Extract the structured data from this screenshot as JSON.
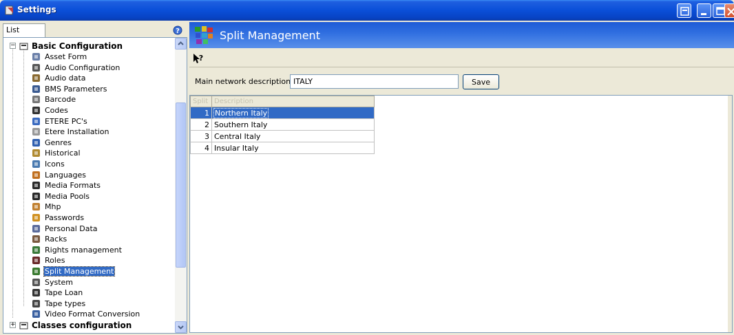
{
  "window": {
    "title": "Settings"
  },
  "left": {
    "tab_label": "List",
    "groups": [
      {
        "label": "Basic Configuration",
        "expanded": true,
        "items": [
          {
            "label": "Asset Form",
            "icon": "asset-form-icon"
          },
          {
            "label": "Audio Configuration",
            "icon": "audio-config-icon"
          },
          {
            "label": "Audio data",
            "icon": "audio-data-icon"
          },
          {
            "label": "BMS Parameters",
            "icon": "bms-icon"
          },
          {
            "label": "Barcode",
            "icon": "barcode-icon"
          },
          {
            "label": "Codes",
            "icon": "codes-icon"
          },
          {
            "label": "ETERE PC's",
            "icon": "pc-icon"
          },
          {
            "label": "Etere Installation",
            "icon": "installation-icon"
          },
          {
            "label": "Genres",
            "icon": "genres-icon"
          },
          {
            "label": "Historical",
            "icon": "historical-icon"
          },
          {
            "label": "Icons",
            "icon": "icons-icon"
          },
          {
            "label": "Languages",
            "icon": "languages-icon"
          },
          {
            "label": "Media Formats",
            "icon": "media-formats-icon"
          },
          {
            "label": "Media Pools",
            "icon": "media-pools-icon"
          },
          {
            "label": "Mhp",
            "icon": "mhp-icon"
          },
          {
            "label": "Passwords",
            "icon": "passwords-icon"
          },
          {
            "label": "Personal Data",
            "icon": "personal-data-icon"
          },
          {
            "label": "Racks",
            "icon": "racks-icon"
          },
          {
            "label": "Rights management",
            "icon": "rights-icon"
          },
          {
            "label": "Roles",
            "icon": "roles-icon"
          },
          {
            "label": "Split Management",
            "icon": "split-icon",
            "selected": true
          },
          {
            "label": "System",
            "icon": "system-icon"
          },
          {
            "label": "Tape Loan",
            "icon": "tape-loan-icon"
          },
          {
            "label": "Tape types",
            "icon": "tape-types-icon"
          },
          {
            "label": "Video Format Conversion",
            "icon": "video-format-icon"
          }
        ]
      },
      {
        "label": "Classes configuration",
        "expanded": false
      }
    ]
  },
  "right": {
    "header_title": "Split Management",
    "form": {
      "network_label": "Main network description",
      "network_value": "ITALY",
      "save_label": "Save"
    },
    "grid": {
      "columns": [
        "Split",
        "Description"
      ],
      "rows": [
        {
          "num": "1",
          "desc": "Northern Italy",
          "selected": true
        },
        {
          "num": "2",
          "desc": "Southern Italy"
        },
        {
          "num": "3",
          "desc": "Central Italy"
        },
        {
          "num": "4",
          "desc": "Insular Italy"
        }
      ]
    }
  },
  "colors": {
    "title_bar": "#0a4fd8",
    "header": "#1d5ad6",
    "selection": "#316ac5"
  }
}
